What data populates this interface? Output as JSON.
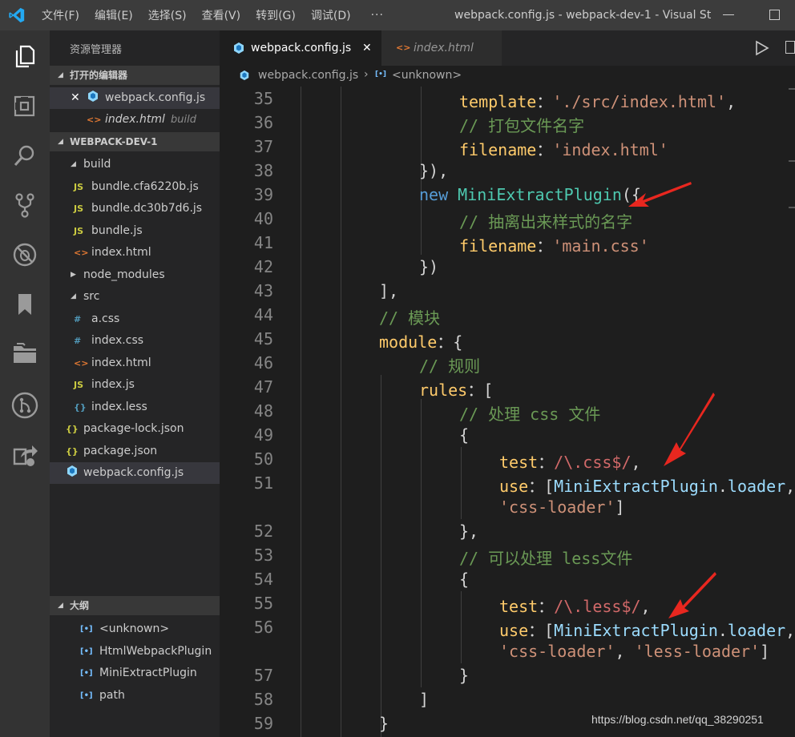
{
  "titlebar": {
    "menu": [
      "文件(F)",
      "编辑(E)",
      "选择(S)",
      "查看(V)",
      "转到(G)",
      "调试(D)"
    ],
    "more": "···",
    "title": "webpack.config.js - webpack-dev-1 - Visual St..."
  },
  "activity_icons": [
    "explorer-icon",
    "extensions-icon",
    "search-icon",
    "source-control-icon",
    "debug-icon",
    "bookmark-icon",
    "folder-icon",
    "remote-icon",
    "live-share-icon"
  ],
  "sidebar": {
    "title": "资源管理器",
    "open_editors": {
      "header": "打开的编辑器",
      "items": [
        {
          "name": "webpack.config.js",
          "close": "✕"
        },
        {
          "name": "index.html",
          "folder": "build"
        }
      ]
    },
    "project": {
      "header": "WEBPACK-DEV-1",
      "items": [
        {
          "name": "build",
          "kind": "folder-open",
          "icon": ""
        },
        {
          "name": "bundle.cfa6220b.js",
          "kind": "js",
          "icon": "JS"
        },
        {
          "name": "bundle.dc30b7d6.js",
          "kind": "js",
          "icon": "JS"
        },
        {
          "name": "bundle.js",
          "kind": "js",
          "icon": "JS"
        },
        {
          "name": "index.html",
          "kind": "html",
          "icon": "<>"
        },
        {
          "name": "node_modules",
          "kind": "folder-closed",
          "icon": ""
        },
        {
          "name": "src",
          "kind": "folder-open",
          "icon": ""
        },
        {
          "name": "a.css",
          "kind": "css",
          "icon": "#"
        },
        {
          "name": "index.css",
          "kind": "css",
          "icon": "#"
        },
        {
          "name": "index.html",
          "kind": "html",
          "icon": "<>"
        },
        {
          "name": "index.js",
          "kind": "js",
          "icon": "JS"
        },
        {
          "name": "index.less",
          "kind": "less",
          "icon": "{}"
        },
        {
          "name": "package-lock.json",
          "kind": "json",
          "icon": "{}"
        },
        {
          "name": "package.json",
          "kind": "json",
          "icon": "{}"
        },
        {
          "name": "webpack.config.js",
          "kind": "webpack",
          "icon": ""
        }
      ]
    },
    "outline": {
      "header": "大纲",
      "items": [
        "<unknown>",
        "HtmlWebpackPlugin",
        "MiniExtractPlugin",
        "path"
      ]
    }
  },
  "tabs": [
    {
      "label": "webpack.config.js",
      "close": "✕",
      "active": true
    },
    {
      "label": "index.html",
      "active": false
    }
  ],
  "breadcrumb": {
    "file": "webpack.config.js",
    "separator": "›",
    "symbol": "<unknown>"
  },
  "line_numbers": [
    "35",
    "36",
    "37",
    "38",
    "39",
    "40",
    "41",
    "42",
    "43",
    "44",
    "45",
    "46",
    "47",
    "48",
    "49",
    "50",
    "51",
    "",
    "52",
    "53",
    "54",
    "55",
    "56",
    "",
    "57",
    "58",
    "59"
  ],
  "code_lines": [
    [
      [
        "k-prop",
        "template"
      ],
      [
        "",
        "："
      ],
      [
        "k-str",
        "'./src/index.html'"
      ],
      [
        "",
        ","
      ]
    ],
    [
      [
        "k-com",
        "// 打包文件名字"
      ]
    ],
    [
      [
        "k-prop",
        "filename"
      ],
      [
        "",
        "："
      ],
      [
        "k-str",
        "'index.html'"
      ]
    ],
    [
      [
        "",
        "}),"
      ]
    ],
    [
      [
        "k-new",
        "new "
      ],
      [
        "k-cls",
        "MiniExtractPlugin"
      ],
      [
        "",
        "({"
      ]
    ],
    [
      [
        "k-com",
        "// 抽离出来样式的名字"
      ]
    ],
    [
      [
        "k-prop",
        "filename"
      ],
      [
        "",
        "："
      ],
      [
        "k-str",
        "'main.css'"
      ]
    ],
    [
      [
        "",
        "})"
      ]
    ],
    [
      [
        "",
        "],"
      ]
    ],
    [
      [
        "k-com",
        "// 模块"
      ]
    ],
    [
      [
        "k-prop",
        "module"
      ],
      [
        "",
        "：{"
      ]
    ],
    [
      [
        "k-com",
        "// 规则"
      ]
    ],
    [
      [
        "k-prop",
        "rules"
      ],
      [
        "",
        "：["
      ]
    ],
    [
      [
        "k-com",
        "// 处理 css 文件"
      ]
    ],
    [
      [
        "",
        "{"
      ]
    ],
    [
      [
        "k-prop",
        "test"
      ],
      [
        "",
        "："
      ],
      [
        "k-reg",
        "/\\.css$/"
      ],
      [
        "",
        ","
      ]
    ],
    [
      [
        "k-prop",
        "use"
      ],
      [
        "",
        "：["
      ],
      [
        "k-var",
        "MiniExtractPlugin"
      ],
      [
        "",
        "."
      ],
      [
        "k-var",
        "loader"
      ],
      [
        "",
        ","
      ]
    ],
    [
      [
        "k-str",
        "'css-loader'"
      ],
      [
        "",
        "]"
      ]
    ],
    [
      [
        "",
        "},"
      ]
    ],
    [
      [
        "k-com",
        "// 可以处理 less文件"
      ]
    ],
    [
      [
        "",
        "{"
      ]
    ],
    [
      [
        "k-prop",
        "test"
      ],
      [
        "",
        "："
      ],
      [
        "k-reg",
        "/\\.less$/"
      ],
      [
        "",
        ","
      ]
    ],
    [
      [
        "k-prop",
        "use"
      ],
      [
        "",
        "：["
      ],
      [
        "k-var",
        "MiniExtractPlugin"
      ],
      [
        "",
        "."
      ],
      [
        "k-var",
        "loader"
      ],
      [
        "",
        ","
      ]
    ],
    [
      [
        "k-str",
        "'css-loader'"
      ],
      [
        "",
        ", "
      ],
      [
        "k-str",
        "'less-loader'"
      ],
      [
        "",
        "]"
      ]
    ],
    [
      [
        "",
        "}"
      ]
    ],
    [
      [
        "",
        "]"
      ]
    ],
    [
      [
        "",
        "}"
      ]
    ]
  ],
  "code_indent": [
    8,
    8,
    8,
    6,
    6,
    8,
    8,
    6,
    4,
    4,
    4,
    6,
    6,
    8,
    8,
    10,
    10,
    10,
    8,
    8,
    8,
    10,
    10,
    10,
    8,
    6,
    4
  ],
  "watermark": "https://blog.csdn.net/qq_38290251"
}
